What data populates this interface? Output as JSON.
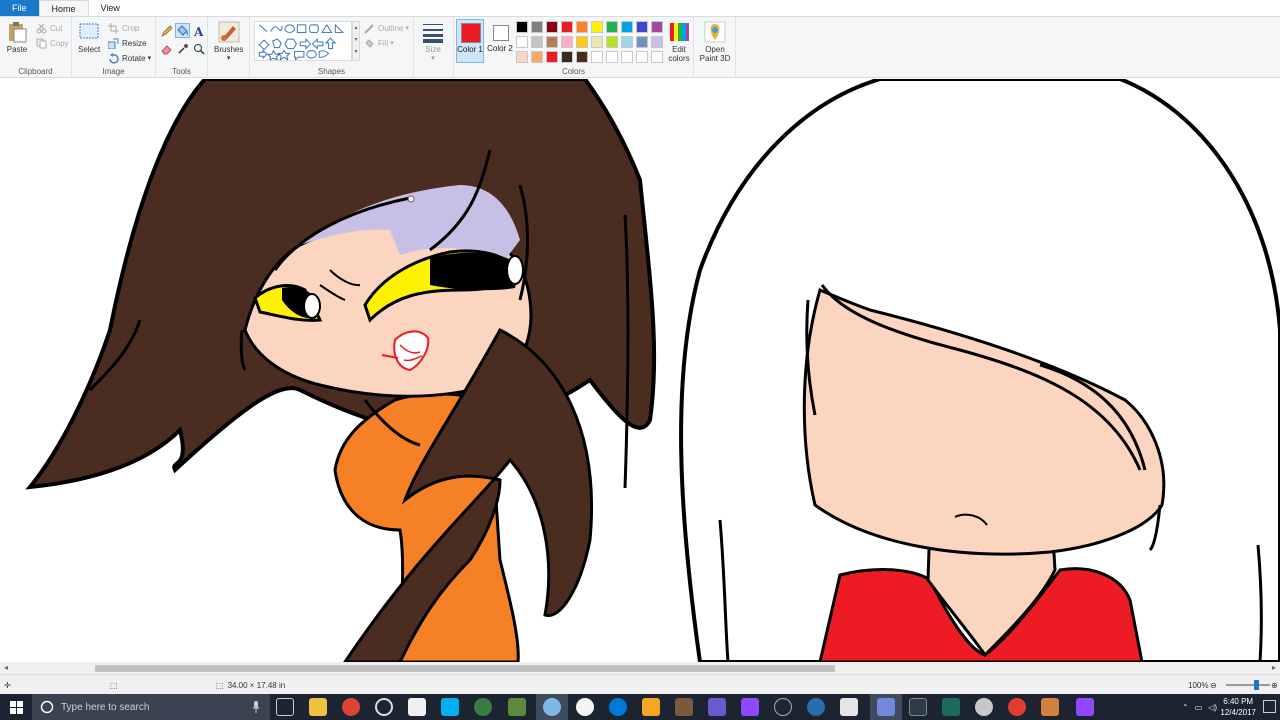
{
  "menu": {
    "file": "File",
    "home": "Home",
    "view": "View"
  },
  "clipboard": {
    "paste": "Paste",
    "cut": "Cut",
    "copy": "Copy",
    "label": "Clipboard"
  },
  "image": {
    "select": "Select",
    "crop": "Crop",
    "resize": "Resize",
    "rotate": "Rotate",
    "label": "Image"
  },
  "tools": {
    "label": "Tools"
  },
  "brushes": {
    "label": "Brushes"
  },
  "shapes": {
    "outline": "Outline",
    "fill": "Fill",
    "label": "Shapes"
  },
  "size": {
    "label": "Size"
  },
  "colors": {
    "color1": "Color 1",
    "color2": "Color 2",
    "color1_value": "#ed1c24",
    "color2_value": "#ffffff",
    "edit": "Edit colors",
    "label": "Colors",
    "palette": [
      "#000000",
      "#7f7f7f",
      "#880015",
      "#ed1c24",
      "#ff7f27",
      "#fff200",
      "#22b14c",
      "#00a2e8",
      "#3f48cc",
      "#a349a4",
      "#ffffff",
      "#c3c3c3",
      "#b97a57",
      "#ffaec9",
      "#ffc90e",
      "#efe4b0",
      "#b5e61d",
      "#99d9ea",
      "#7092be",
      "#c8bfe7",
      "#fcd5c0",
      "#f7a86a",
      "#ed1c24",
      "#3b2a20",
      "#4a2c20",
      "#ffffff",
      "#ffffff",
      "#ffffff",
      "#ffffff",
      "#ffffff"
    ]
  },
  "paint3d": {
    "label": "Open Paint 3D"
  },
  "status": {
    "dimensions": "34.00 × 17.48 in",
    "zoom": "100%"
  },
  "taskbar": {
    "search_placeholder": "Type here to search",
    "time": "6:40 PM",
    "date": "12/4/2017"
  }
}
